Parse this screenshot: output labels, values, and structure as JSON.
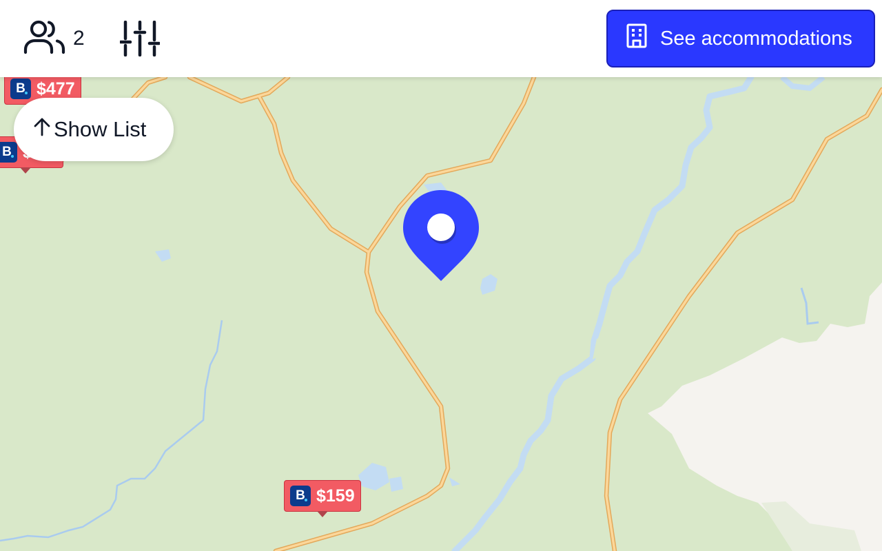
{
  "colors": {
    "accent": "#3344ff",
    "price_tag": "#f25b63",
    "booking_brand": "#0c3b8c",
    "map_land": "#d9e8c9",
    "map_road": "#f3c27c",
    "map_water": "#c3dcf3",
    "map_bare": "#f5f3ef"
  },
  "header": {
    "guests_icon": "users-icon",
    "guest_count": "2",
    "filters_icon": "sliders-icon",
    "accommodations_icon": "building-icon",
    "accommodations_label": "See accommodations"
  },
  "list_toggle": {
    "icon": "arrow-up-icon",
    "label": "Show List"
  },
  "price_markers": [
    {
      "provider_icon": "booking-b-icon",
      "price": "$477"
    },
    {
      "provider_icon": "booking-b-icon",
      "price": "$"
    },
    {
      "provider_icon": "booking-b-icon",
      "price": "$159"
    }
  ],
  "location_pin": {
    "icon": "map-pin-icon"
  }
}
